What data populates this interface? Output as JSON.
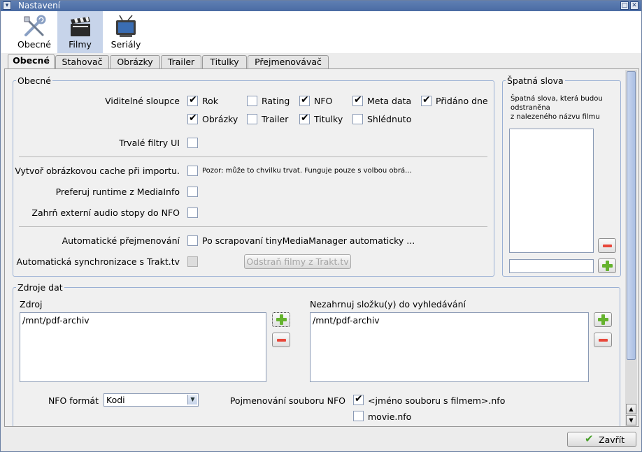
{
  "window": {
    "title": "Nastavení"
  },
  "toolbar": {
    "items": [
      {
        "label": "Obecné"
      },
      {
        "label": "Filmy"
      },
      {
        "label": "Seriály"
      }
    ]
  },
  "tabs": [
    "Obecné",
    "Stahovač",
    "Obrázky",
    "Trailer",
    "Titulky",
    "Přejmenovávač"
  ],
  "general": {
    "legend": "Obecné",
    "visible_columns_label": "Viditelné sloupce",
    "columns": [
      {
        "label": "Rok",
        "checked": true
      },
      {
        "label": "Rating",
        "checked": false
      },
      {
        "label": "NFO",
        "checked": true
      },
      {
        "label": "Meta data",
        "checked": true
      },
      {
        "label": "Přidáno dne",
        "checked": true
      },
      {
        "label": "Obrázky",
        "checked": true
      },
      {
        "label": "Trailer",
        "checked": false
      },
      {
        "label": "Titulky",
        "checked": true
      },
      {
        "label": "Shlédnuto",
        "checked": false
      }
    ],
    "persistent_filters_label": "Trvalé filtry UI",
    "image_cache_label": "Vytvoř obrázkovou cache při importu.",
    "image_cache_hint": "Pozor: může to chvilku trvat. Funguje pouze s volbou obrá...",
    "runtime_label": "Preferuj runtime z MediaInfo",
    "external_audio_label": "Zahrň externí audio stopy do NFO",
    "auto_rename_label": "Automatické přejmenování",
    "auto_rename_hint": "Po scrapovaní tinyMediaManager automaticky ...",
    "trakt_sync_label": "Automatická synchronizace s Trakt.tv",
    "trakt_remove_button": "Odstraň filmy z Trakt.tv"
  },
  "bad_words": {
    "legend": "Špatná slova",
    "description_lines": [
      "Špatná slova, která budou",
      "odstraněna",
      "z nalezeného názvu filmu"
    ],
    "input_value": ""
  },
  "sources": {
    "legend": "Zdroje dat",
    "source_label": "Zdroj",
    "source_items": [
      "/mnt/pdf-archiv"
    ],
    "exclude_label": "Nezahrnuj složku(y) do vyhledávání",
    "exclude_items": [
      "/mnt/pdf-archiv"
    ],
    "nfo_format_label": "NFO formát",
    "nfo_format_value": "Kodi",
    "nfo_naming_label": "Pojmenování souboru NFO",
    "nfo_naming_options": [
      {
        "label": "<jméno souboru s filmem>.nfo",
        "checked": true
      },
      {
        "label": "movie.nfo",
        "checked": false
      }
    ]
  },
  "footer": {
    "close_label": "Zavřít"
  },
  "colors": {
    "titlebar": "#4f6fa6",
    "active_toolbar": "#c7d4ea",
    "group_border": "#9ab0d4"
  }
}
